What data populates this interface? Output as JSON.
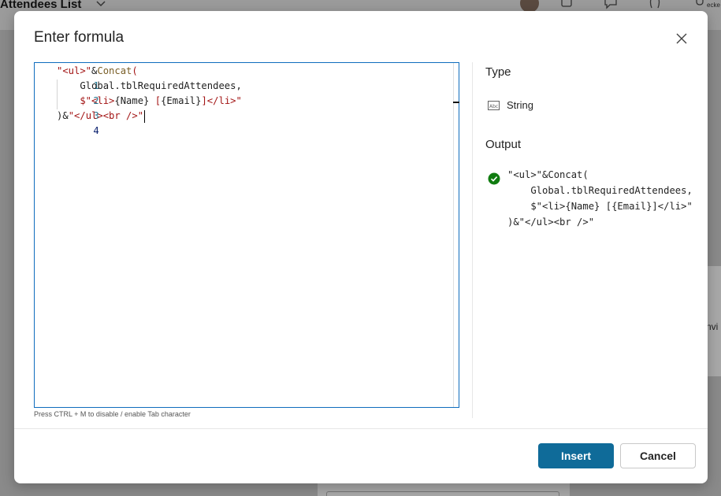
{
  "background": {
    "app_title": "Attendees List",
    "user_label": "ecke",
    "side_panel_text": "nvi"
  },
  "dialog": {
    "title": "Enter formula",
    "editor": {
      "line_numbers": [
        "1",
        "2",
        "3",
        "4"
      ],
      "hint": "Press CTRL + M to disable / enable Tab character"
    },
    "type_section": {
      "label": "Type",
      "icon": "string-type-icon",
      "value": "String"
    },
    "output_section": {
      "label": "Output",
      "status_icon": "success-check-icon",
      "lines": [
        "\"<ul>\"&Concat(",
        "    Global.tblRequiredAttendees,",
        "    $\"<li>{Name} [{Email}]</li>\"",
        ")&\"</ul><br />\""
      ]
    },
    "buttons": {
      "insert": "Insert",
      "cancel": "Cancel"
    }
  },
  "colors": {
    "accent": "#0f6b99",
    "editor_border": "#0f6cbd",
    "string": "#a31515",
    "function": "#795e26",
    "success": "#107c10"
  }
}
